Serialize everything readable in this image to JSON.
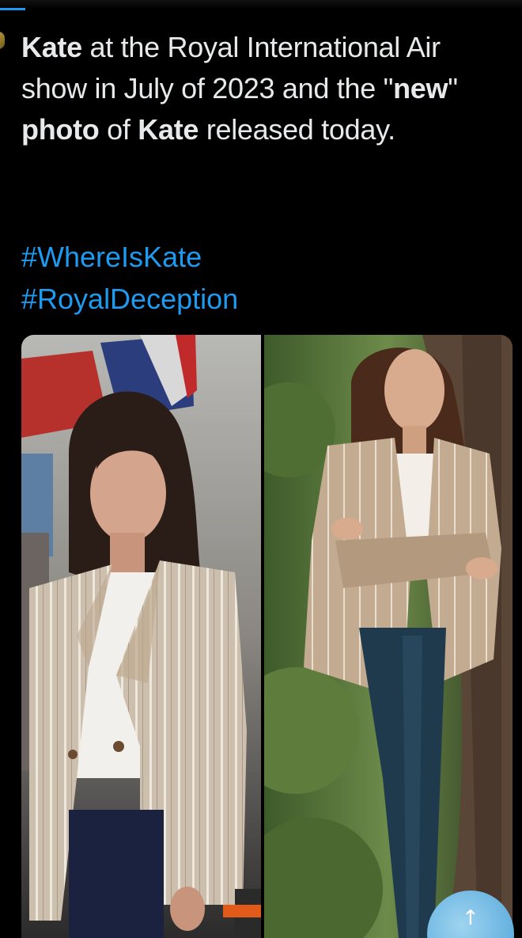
{
  "tweet": {
    "text_parts": [
      {
        "text": "Kate",
        "bold": true
      },
      {
        "text": " at the Royal International Air show in July of 2023 and the \"",
        "bold": false
      },
      {
        "text": "new",
        "bold": true
      },
      {
        "text": "\" ",
        "bold": false
      },
      {
        "text": "photo",
        "bold": true
      },
      {
        "text": " of ",
        "bold": false
      },
      {
        "text": "Kate",
        "bold": true
      },
      {
        "text": " released today.",
        "bold": false
      }
    ],
    "hashtags": [
      "#WhereIsKate",
      "#RoyalDeception"
    ]
  },
  "media": {
    "left_photo": "air-show-photo",
    "right_photo": "tree-photo"
  },
  "colors": {
    "background": "#000000",
    "text": "#e7e9ea",
    "link": "#1d9bf0",
    "progress": "#1d9bf0"
  },
  "icons": {
    "corner_badge": "reply-badge-icon"
  }
}
